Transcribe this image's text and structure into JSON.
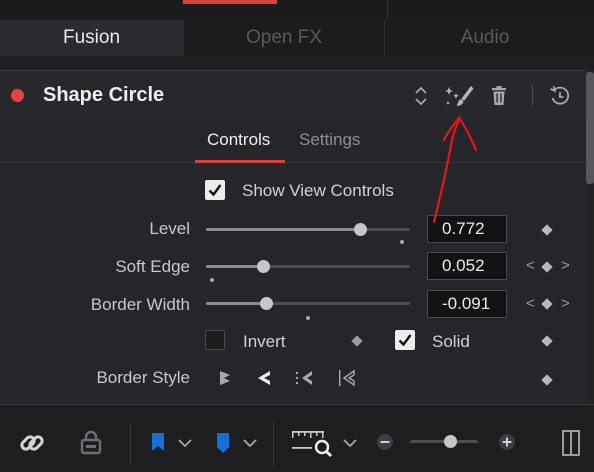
{
  "mode_tabs": [
    {
      "label": "Fusion",
      "active": true
    },
    {
      "label": "Open FX",
      "active": false
    },
    {
      "label": "Audio",
      "active": false
    }
  ],
  "tool": {
    "title": "Shape Circle",
    "enabled_color": "#e24444",
    "header_icons": [
      "expand-collapse-icon",
      "magic-wand-brush-icon",
      "trash-icon",
      "reset-icon"
    ]
  },
  "subtabs": [
    {
      "label": "Controls",
      "active": true
    },
    {
      "label": "Settings",
      "active": false
    }
  ],
  "controls": {
    "show_view_controls": {
      "label": "Show View Controls",
      "checked": true
    },
    "level": {
      "label": "Level",
      "value": "0.772",
      "slider_fraction": 0.77
    },
    "soft_edge": {
      "label": "Soft Edge",
      "value": "0.052",
      "slider_fraction": 0.28
    },
    "border_width": {
      "label": "Border Width",
      "value": "-0.091",
      "slider_fraction": 0.29
    },
    "invert": {
      "label": "Invert",
      "checked": false
    },
    "solid": {
      "label": "Solid",
      "checked": true
    },
    "border_style": {
      "label": "Border Style",
      "options": [
        "border-style-1-icon",
        "border-style-2-icon",
        "border-style-3-icon",
        "border-style-4-icon"
      ],
      "selected_index": 1
    }
  },
  "toolbar": {
    "icons": [
      "link-icon",
      "lock-icon",
      "blue-flag-icon",
      "blue-marker-icon",
      "zoom-ruler-icon",
      "minus-icon",
      "plus-icon",
      "panel-toggle-icon"
    ],
    "zoom_fraction": 0.5
  },
  "colors": {
    "accent": "#d5443c",
    "flag_blue": "#1a6fd6",
    "annotation_red": "#e01818"
  }
}
